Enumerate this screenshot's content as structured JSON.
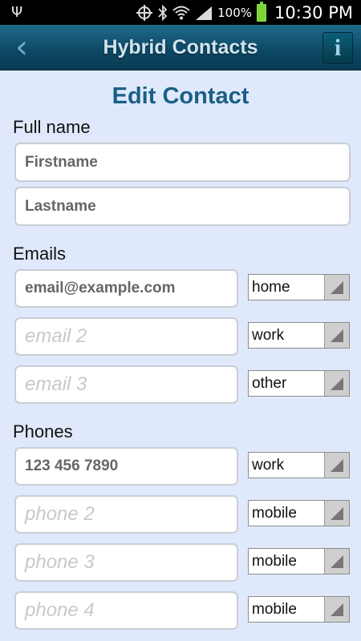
{
  "status_bar": {
    "battery_percent": "100%",
    "time": "10:30 PM"
  },
  "header": {
    "title": "Hybrid Contacts",
    "info_label": "i"
  },
  "page_title": "Edit Contact",
  "full_name": {
    "label": "Full name",
    "firstname_value": "Firstname",
    "lastname_value": "Lastname"
  },
  "emails": {
    "label": "Emails",
    "items": [
      {
        "value": "email@example.com",
        "placeholder": "",
        "type": "home"
      },
      {
        "value": "",
        "placeholder": "email 2",
        "type": "work"
      },
      {
        "value": "",
        "placeholder": "email 3",
        "type": "other"
      }
    ]
  },
  "phones": {
    "label": "Phones",
    "items": [
      {
        "value": "123 456 7890",
        "placeholder": "",
        "type": "work"
      },
      {
        "value": "",
        "placeholder": "phone 2",
        "type": "mobile"
      },
      {
        "value": "",
        "placeholder": "phone 3",
        "type": "mobile"
      },
      {
        "value": "",
        "placeholder": "phone 4",
        "type": "mobile"
      }
    ]
  }
}
